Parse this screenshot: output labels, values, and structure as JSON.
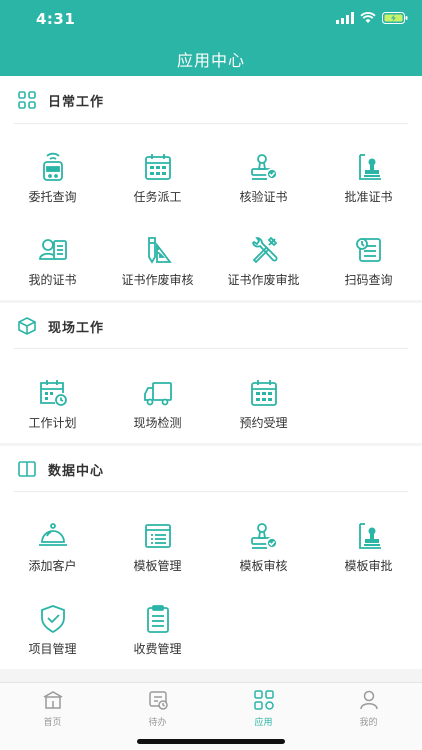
{
  "status_bar": {
    "time": "4:31"
  },
  "header": {
    "title": "应用中心"
  },
  "colors": {
    "brand": "#2bb5a6",
    "tab_inactive": "#9a9a9a"
  },
  "sections": [
    {
      "title": "日常工作",
      "icon": "grid-icon",
      "items": [
        {
          "label": "委托查询",
          "icon": "wifi-device-icon"
        },
        {
          "label": "任务派工",
          "icon": "calendar-icon"
        },
        {
          "label": "核验证书",
          "icon": "stamp-check-icon"
        },
        {
          "label": "批准证书",
          "icon": "seal-stamp-icon"
        },
        {
          "label": "我的证书",
          "icon": "person-card-icon"
        },
        {
          "label": "证书作废审核",
          "icon": "ruler-pencil-icon"
        },
        {
          "label": "证书作废审批",
          "icon": "tools-icon"
        },
        {
          "label": "扫码查询",
          "icon": "scan-document-icon"
        }
      ]
    },
    {
      "title": "现场工作",
      "icon": "cube-icon",
      "items": [
        {
          "label": "工作计划",
          "icon": "calendar-clock-icon"
        },
        {
          "label": "现场检测",
          "icon": "truck-icon"
        },
        {
          "label": "预约受理",
          "icon": "calendar-icon"
        }
      ]
    },
    {
      "title": "数据中心",
      "icon": "book-icon",
      "items": [
        {
          "label": "添加客户",
          "icon": "service-bell-icon"
        },
        {
          "label": "模板管理",
          "icon": "template-list-icon"
        },
        {
          "label": "模板审核",
          "icon": "stamp-check-icon"
        },
        {
          "label": "模板审批",
          "icon": "seal-stamp-icon"
        },
        {
          "label": "项目管理",
          "icon": "shield-check-icon"
        },
        {
          "label": "收费管理",
          "icon": "clipboard-list-icon"
        }
      ]
    }
  ],
  "tabs": [
    {
      "label": "首页",
      "icon": "home-icon",
      "active": false
    },
    {
      "label": "待办",
      "icon": "todo-icon",
      "active": false
    },
    {
      "label": "应用",
      "icon": "apps-icon",
      "active": true
    },
    {
      "label": "我的",
      "icon": "user-icon",
      "active": false
    }
  ]
}
